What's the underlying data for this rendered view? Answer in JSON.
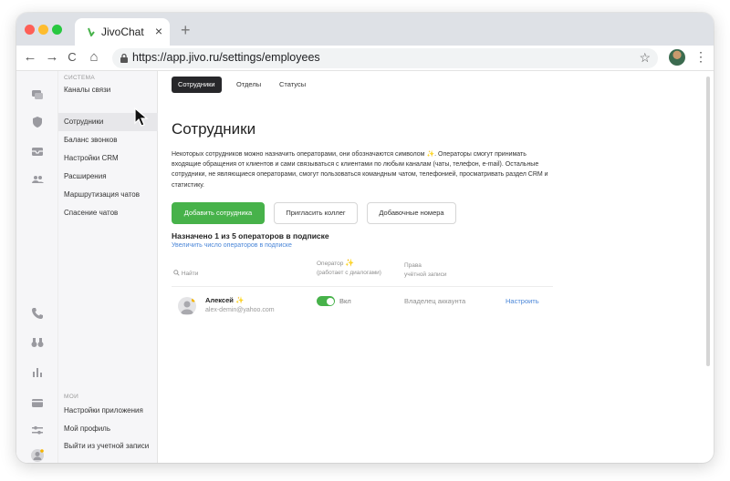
{
  "browser": {
    "tab_title": "JivoChat",
    "tab_close": "×",
    "new_tab": "+",
    "url": "https://app.jivo.ru/settings/employees",
    "back": "←",
    "forward": "→",
    "reload": "C",
    "home": "⌂",
    "bookmark": "☆",
    "menu": "⋮"
  },
  "sidebar": {
    "section_system": "СИСТЕМА",
    "items": [
      {
        "label": "Каналы связи"
      },
      {
        "label": "Сотрудники"
      },
      {
        "label": "Баланс звонков"
      },
      {
        "label": "Настройки CRM"
      },
      {
        "label": "Расширения"
      },
      {
        "label": "Маршрутизация чатов"
      },
      {
        "label": "Спасение чатов"
      }
    ],
    "section_mine": "МОИ",
    "bottom_items": [
      {
        "label": "Настройки приложения"
      },
      {
        "label": "Мой профиль"
      },
      {
        "label": "Выйти из учетной записи"
      }
    ]
  },
  "main": {
    "tabs": [
      {
        "label": "Сотрудники"
      },
      {
        "label": "Отделы"
      },
      {
        "label": "Статусы"
      }
    ],
    "title": "Сотрудники",
    "description_part1": "Некоторых сотрудников можно назначить операторами, они обозначаются символом",
    "description_part2": ". Операторы смогут принимать входящие обращения от клиентов и сами связываться с клиентами по любым каналам (чаты, телефон, e-mail). Остальные сотрудники, не являющиеся операторами, смогут пользоваться командным чатом, телефонией, просматривать раздел CRM и статистику.",
    "buttons": {
      "add": "Добавить сотрудника",
      "invite": "Пригласить коллег",
      "extensions": "Добавочные номера"
    },
    "assigned": "Назначено 1 из 5 операторов в подписке",
    "increase_link": "Увеличить число операторов в подписке",
    "table": {
      "search_placeholder": "Найти",
      "col_operator_line1": "Оператор",
      "col_operator_line2": "(работает с диалогами)",
      "col_rights_line1": "Права",
      "col_rights_line2": "учётной записи"
    },
    "rows": [
      {
        "name": "Алексей",
        "email": "alex-demin@yahoo.com",
        "toggle_label": "Вкл",
        "role": "Владелец аккаунта",
        "action": "Настроить"
      }
    ]
  },
  "colors": {
    "accent_green": "#47b24a",
    "link_blue": "#4a86d8",
    "operator_sparkle": "#f5b400"
  }
}
